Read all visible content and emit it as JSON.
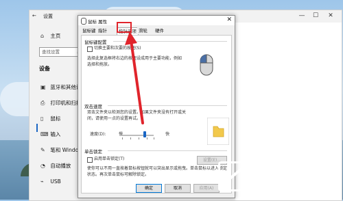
{
  "settings": {
    "title": "设置",
    "nav": [
      {
        "icon": "home-icon",
        "glyph": "⌂",
        "label": "主页"
      },
      {
        "icon": "bluetooth-icon",
        "glyph": "▣",
        "label": "蓝牙和其他设备"
      },
      {
        "icon": "printer-icon",
        "glyph": "⎙",
        "label": "打印机和扫描仪"
      },
      {
        "icon": "mouse-icon",
        "glyph": "▯",
        "label": "鼠标"
      },
      {
        "icon": "keyboard-icon",
        "glyph": "⌨",
        "label": "输入"
      },
      {
        "icon": "pen-icon",
        "glyph": "✎",
        "label": "笔和 Windows"
      },
      {
        "icon": "autoplay-icon",
        "glyph": "◔",
        "label": "自动播放"
      },
      {
        "icon": "usb-icon",
        "glyph": "⌁",
        "label": "USB"
      }
    ],
    "search_placeholder": "查找设置",
    "group_title": "设备",
    "window_controls": {
      "minimize": "—",
      "maximize": "☐",
      "close": "✕"
    }
  },
  "dialog": {
    "title": "鼠标 属性",
    "tabs": [
      "鼠标键",
      "指针",
      "指针选项",
      "滑轮",
      "硬件"
    ],
    "selected_tab": "指针选项",
    "button_config": {
      "title": "鼠标键配置",
      "checkbox_label": "切换主要和次要的按钮(S)",
      "description": "选择此复选框将右边的按钮设成用于主要功能，例如选择和拖放。"
    },
    "double_click": {
      "title": "双击速度",
      "description": "双击文件夹以检测您的设置。如果文件夹没有打开或关闭，请使用一点的设置再试。",
      "speed_label": "速度(D):",
      "slow": "慢",
      "fast": "快",
      "speed_value": 0.72
    },
    "click_lock": {
      "title": "单击锁定",
      "checkbox_label": "启用单击锁定(T)",
      "settings_button": "设置(E)...",
      "description": "使你可以不用一直按着鼠标按钮就可以突出显示或拖曳。单击鼠标以进入锁定状态。再次单击鼠标可解除锁定。"
    },
    "ok": "确定",
    "cancel": "取消",
    "apply": "应用(A)"
  },
  "watermark": {
    "brand": "爱纯净",
    "url": "aichunjing.com"
  },
  "colors": {
    "highlight": "#e0242b",
    "accent": "#1a66c4"
  }
}
